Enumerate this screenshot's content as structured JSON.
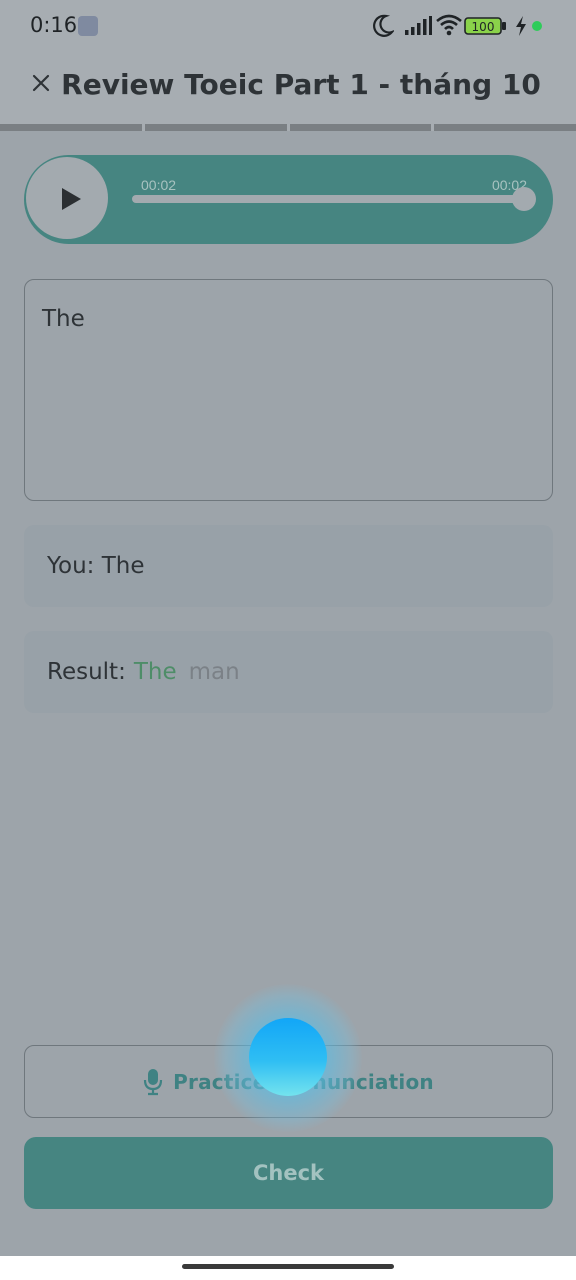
{
  "status_bar": {
    "time": "0:16",
    "battery": "100"
  },
  "header": {
    "title": "Review Toeic Part 1 - tháng 10",
    "progress_segments": 4
  },
  "audio": {
    "current_time": "00:02",
    "total_time": "00:02",
    "progress": 1.0
  },
  "answer": {
    "value": "The"
  },
  "you": {
    "text": "You: The"
  },
  "result": {
    "label": "Result:",
    "correct_word": "The",
    "missing_word": "man"
  },
  "practice": {
    "label": "Practice Pronunciation"
  },
  "check": {
    "label": "Check"
  },
  "colors": {
    "accent": "#468581",
    "correct": "#4e8d68",
    "missing": "#7b8187",
    "orb": "#12a6f7"
  }
}
